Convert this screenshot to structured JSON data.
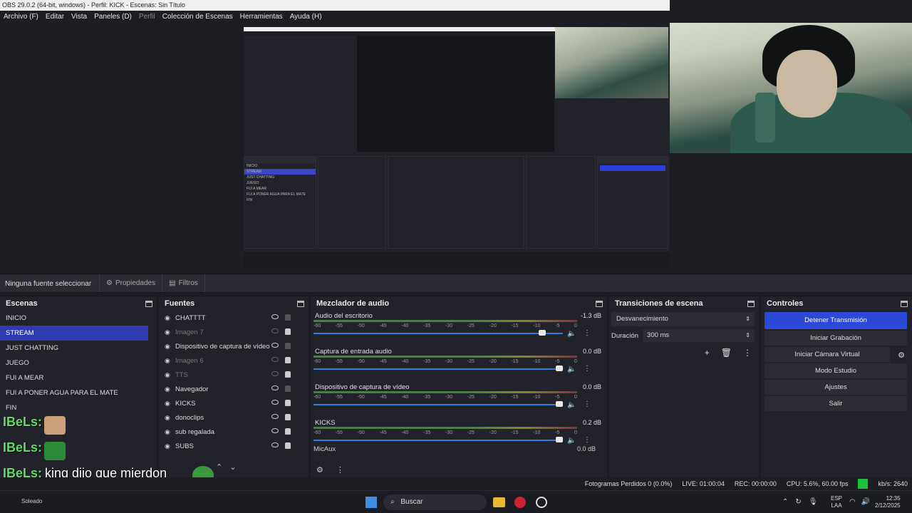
{
  "titlebar": {
    "title": "OBS 29.0.2 (64-bit, windows) - Perfil: KICK - Escenas: Sin Título"
  },
  "menu": [
    {
      "label": "Archivo (F)",
      "dim": false
    },
    {
      "label": "Editar",
      "dim": false
    },
    {
      "label": "Vista",
      "dim": false
    },
    {
      "label": "Paneles (D)",
      "dim": false
    },
    {
      "label": "Perfil",
      "dim": true
    },
    {
      "label": "Colección de Escenas",
      "dim": false
    },
    {
      "label": "Herramientas",
      "dim": false
    },
    {
      "label": "Ayuda (H)",
      "dim": false
    }
  ],
  "source_toolbar": {
    "no_source": "Ninguna fuente seleccionar",
    "properties": "Propiedades",
    "filters": "Filtros"
  },
  "scenes": {
    "title": "Escenas",
    "items": [
      {
        "label": "INICIO",
        "selected": false
      },
      {
        "label": "STREAM",
        "selected": true
      },
      {
        "label": "JUST CHATTING",
        "selected": false
      },
      {
        "label": "JUEGO",
        "selected": false
      },
      {
        "label": "FUI A MEAR",
        "selected": false
      },
      {
        "label": "FUI A PONER AGUA PARA EL MATE",
        "selected": false
      },
      {
        "label": "FIN",
        "selected": false
      }
    ]
  },
  "sources": {
    "title": "Fuentes",
    "items": [
      {
        "label": "CHATTTT",
        "visible": true,
        "locked": false
      },
      {
        "label": "Imagen 7",
        "visible": false,
        "locked": true
      },
      {
        "label": "Dispositivo de captura de vídeo",
        "visible": true,
        "locked": false
      },
      {
        "label": "Imagen 6",
        "visible": false,
        "locked": true
      },
      {
        "label": "TTS",
        "visible": false,
        "locked": true
      },
      {
        "label": "Navegador",
        "visible": true,
        "locked": false
      },
      {
        "label": "KICKS",
        "visible": true,
        "locked": true
      },
      {
        "label": "donoclips",
        "visible": true,
        "locked": true
      },
      {
        "label": "sub regalada",
        "visible": true,
        "locked": true
      },
      {
        "label": "SUBS",
        "visible": true,
        "locked": true
      }
    ]
  },
  "mixer": {
    "title": "Mezclador de audio",
    "ticks": [
      "-60",
      "-55",
      "-50",
      "-45",
      "-40",
      "-35",
      "-30",
      "-25",
      "-20",
      "-15",
      "-10",
      "-5",
      "0"
    ],
    "channels": [
      {
        "name": "Audio del escritorio",
        "db": "-1.3 dB",
        "level": 0.93,
        "muted": false
      },
      {
        "name": "Captura de entrada audio",
        "db": "0.0 dB",
        "level": 1.0,
        "muted": false
      },
      {
        "name": "Dispositivo de captura de vídeo",
        "db": "0.0 dB",
        "level": 1.0,
        "muted": true
      },
      {
        "name": "KICKS",
        "db": "0.2 dB",
        "level": 1.0,
        "muted": false
      }
    ],
    "partial_channel": "MicAux",
    "partial_db": "0.0 dB"
  },
  "transitions": {
    "title": "Transiciones de escena",
    "selected": "Desvanecimiento",
    "duration_label": "Duración",
    "duration_value": "300 ms"
  },
  "controls": {
    "title": "Controles",
    "stop_stream": "Detener Transmisión",
    "start_recording": "Iniciar Grabación",
    "virtual_cam": "Iniciar Cámara Virtual",
    "studio_mode": "Modo Estudio",
    "settings": "Ajustes",
    "exit": "Salir"
  },
  "status": {
    "dropped": "Fotogramas Perdidos 0 (0.0%)",
    "live": "LIVE: 01:00:04",
    "rec": "REC: 00:00:00",
    "cpu": "CPU: 5.6%, 60.00 fps",
    "kbps": "kb/s: 2640"
  },
  "chat_overlay": {
    "user": "IBeLs:",
    "message": "king dijo que mierdon"
  },
  "taskbar": {
    "search": "Buscar",
    "weather": "Soleado",
    "lang_top": "ESP",
    "lang_bottom": "LAA",
    "time": "12:35",
    "date": "2/12/2025"
  },
  "nested": {
    "scene_items": [
      "INICIO",
      "STREAM",
      "JUST CHATTING",
      "JUEGO",
      "FUI A MEAR",
      "FUI A PONER AGUA PARA EL MATE",
      "FIN"
    ]
  },
  "colors": {
    "accent": "#2b49d6",
    "selected": "#2f3ab0",
    "chat_user": "#66d86a"
  }
}
